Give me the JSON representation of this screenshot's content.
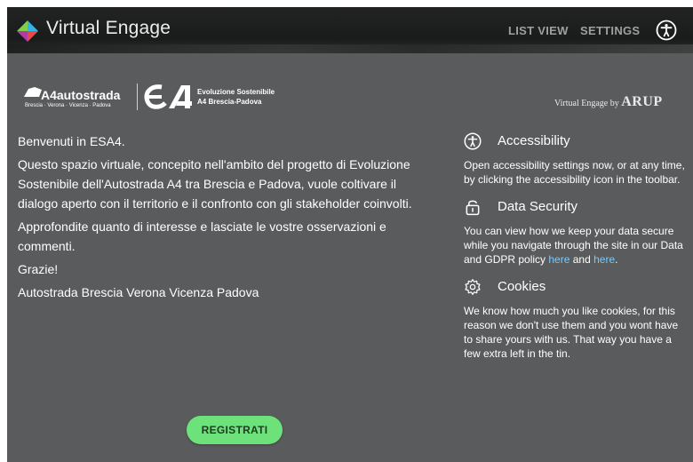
{
  "header": {
    "app_title": "Virtual Engage",
    "nav": {
      "list_view": "LIST VIEW",
      "settings": "SETTINGS"
    },
    "icons": {
      "logo": "diamond-logo-icon",
      "accessibility": "accessibility-icon"
    }
  },
  "brands": {
    "a4_name": "A4autostrada",
    "a4_cities": "Brescia · Verona · Vicenza · Padova",
    "esa_line1": "Evoluzione Sostenibile",
    "esa_line2": "A4 Brescia-Padova",
    "ve_by_prefix": "Virtual Engage by",
    "ve_by_brand": "ARUP"
  },
  "intro": {
    "p1": "Benvenuti in ESA4.",
    "p2": "Questo spazio virtuale, concepito nell'ambito del progetto di Evoluzione Sostenibile dell'Autostrada A4 tra Brescia e Padova, vuole coltivare il dialogo aperto con il territorio e il confronto con gli stakeholder coinvolti.",
    "p3": "Approfondite quanto di interesse e lasciate le vostre osservazioni e commenti.",
    "p4": "Grazie!",
    "p5": "Autostrada Brescia Verona Vicenza Padova"
  },
  "register_button": "REGISTRATI",
  "info": {
    "accessibility": {
      "title": "Accessibility",
      "body": "Open accessibility settings now, or at any time, by clicking the accessibility icon in the toolbar.",
      "icon": "accessibility-icon"
    },
    "security": {
      "title": "Data Security",
      "body_before": "You can view how we keep your data secure while you navigate through the site in our Data and GDPR policy ",
      "link1": "here",
      "body_mid": " and ",
      "link2": "here",
      "body_end": ".",
      "icon": "padlock-icon"
    },
    "cookies": {
      "title": "Cookies",
      "body": "We know how much you like cookies, for this reason we don't use them and you wont have to share yours with us. That way you have a few extra left in the tin.",
      "icon": "gear-icon"
    }
  },
  "colors": {
    "panel_bg": "#5a5b5c",
    "button": "#6ee27a",
    "link": "#7ec8f5"
  }
}
